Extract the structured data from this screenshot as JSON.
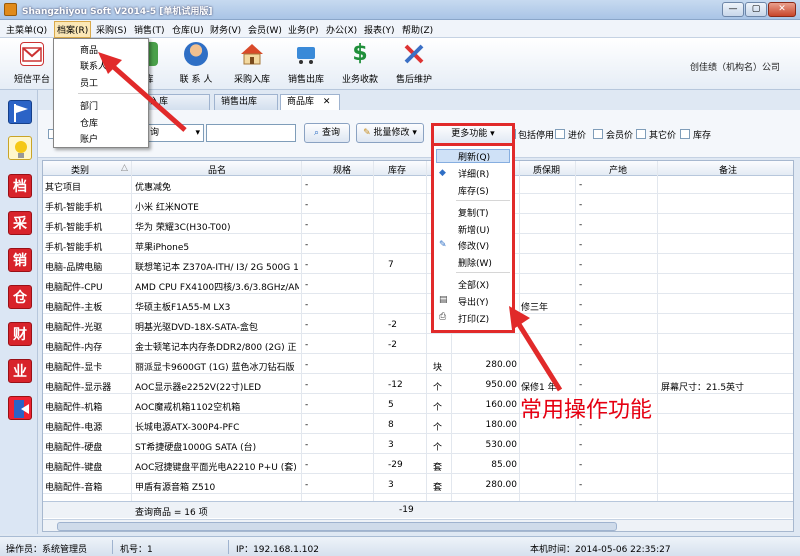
{
  "window": {
    "title": "Shangzhiyou Soft V2014-5 [单机试用版]",
    "min": "—",
    "max": "▢",
    "close": "✕"
  },
  "menu": [
    "主菜单(Q)",
    "档案(R)",
    "采购(S)",
    "销售(T)",
    "仓库(U)",
    "财务(V)",
    "会员(W)",
    "业务(P)",
    "办公(X)",
    "报表(Y)",
    "帮助(Z)"
  ],
  "toolbar": {
    "buttons": [
      "短信平台",
      "库",
      "联 系 人",
      "采购入库",
      "销售出库",
      "业务收款",
      "售后维护"
    ],
    "company": "创佳绩（机构名）公司"
  },
  "archive_menu": {
    "items": [
      "商品",
      "联系人",
      "员工",
      "部门",
      "仓库",
      "账户"
    ]
  },
  "tabs": [
    "购入库",
    "销售出库",
    "商品库"
  ],
  "tab_close": "✕",
  "filter": {
    "query_select": "询",
    "query_button": "查询",
    "batch_button": "批量修改",
    "more_button": "更多功能",
    "checkboxes": [
      "包括停用",
      "进价",
      "会员价",
      "其它价",
      "库存"
    ]
  },
  "grid": {
    "headers": [
      "类别",
      "品名",
      "规格",
      "库存",
      "",
      "",
      "质保期",
      "产地",
      "备注"
    ],
    "rows": [
      [
        "其它项目",
        "优惠减免",
        "-",
        "",
        "",
        "",
        "",
        "-",
        ""
      ],
      [
        "手机-智能手机",
        "小米 红米NOTE",
        "-",
        "",
        "",
        "",
        "",
        "-",
        ""
      ],
      [
        "手机-智能手机",
        "华为 荣耀3C(H30-T00)",
        "-",
        "",
        "",
        "",
        "",
        "-",
        ""
      ],
      [
        "手机-智能手机",
        "苹果iPhone5",
        "-",
        "",
        "",
        "",
        "",
        "-",
        ""
      ],
      [
        "电脑-品牌电脑",
        "联想笔记本 Z370A-ITH/ I3/ 2G 500G 1(",
        "-",
        "7",
        "",
        "",
        "",
        "-",
        ""
      ],
      [
        "电脑配件-CPU",
        "AMD CPU FX4100四核/3.6/3.8GHz/AM",
        "-",
        "",
        "",
        "",
        "",
        "-",
        ""
      ],
      [
        "电脑配件-主板",
        "华硕主板F1A55-M LX3",
        "-",
        "",
        "",
        "",
        "修三年",
        "-",
        ""
      ],
      [
        "电脑配件-光驱",
        "明基光驱DVD-18X-SATA-盒包",
        "-",
        "-2",
        "",
        "",
        "",
        "-",
        ""
      ],
      [
        "电脑配件-内存",
        "金士顿笔记本内存条DDR2/800 (2G) 正",
        "-",
        "-2",
        "",
        "",
        "",
        "-",
        ""
      ],
      [
        "电脑配件-显卡",
        "丽派显卡9600GT (1G) 蓝色冰刀钻石版",
        "-",
        "",
        "块",
        "280.00",
        "",
        "-",
        ""
      ],
      [
        "电脑配件-显示器",
        "AOC显示器e2252V(22寸)LED",
        "-",
        "-12",
        "个",
        "950.00",
        "保修1 年",
        "-",
        "屏幕尺寸：21.5英寸"
      ],
      [
        "电脑配件-机箱",
        "AOC魔戒机箱1102空机箱",
        "-",
        "5",
        "个",
        "160.00",
        "",
        "-",
        ""
      ],
      [
        "电脑配件-电源",
        "长城电源ATX-300P4-PFC",
        "-",
        "8",
        "个",
        "180.00",
        "",
        "-",
        ""
      ],
      [
        "电脑配件-硬盘",
        "ST希捷硬盘1000G SATA (台)",
        "-",
        "3",
        "个",
        "530.00",
        "",
        "-",
        ""
      ],
      [
        "电脑配件-键盘",
        "AOC冠捷键盘平面光电A2210 P+U (套)",
        "-",
        "-29",
        "套",
        "85.00",
        "",
        "-",
        ""
      ],
      [
        "电脑配件-音箱",
        "甲盾有源音箱 Z510",
        "-",
        "3",
        "套",
        "280.00",
        "",
        "-",
        ""
      ]
    ],
    "footer_text": "查询商品 = 16 项",
    "footer_total": "-19"
  },
  "more_menu": {
    "items": [
      "刷新(Q)",
      "详细(R)",
      "库存(S)",
      "复制(T)",
      "新增(U)",
      "修改(V)",
      "删除(W)",
      "全部(X)",
      "导出(Y)",
      "打印(Z)"
    ]
  },
  "annotation": "常用操作功能",
  "status": {
    "operator": "操作员：系统管理员",
    "machine": "机号：1",
    "ip": "IP：192.168.1.102",
    "time": "本机时间：2014-05-06 22:35:27"
  },
  "colors": {
    "highlight_red": "#e12a2a",
    "accent_blue": "#2f6fc5"
  }
}
